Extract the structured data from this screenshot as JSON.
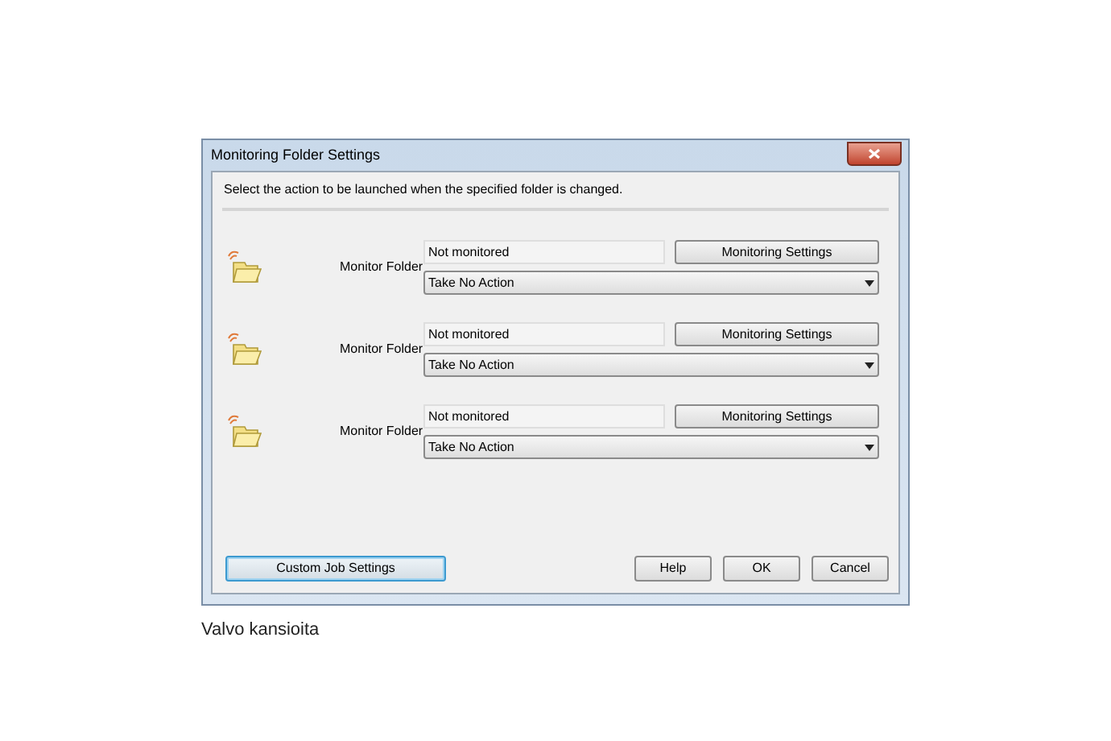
{
  "window": {
    "title": "Monitoring Folder Settings"
  },
  "instruction": "Select the action to be launched when the specified folder is changed.",
  "folders": [
    {
      "label": "Monitor Folder",
      "status": "Not monitored",
      "settings_button": "Monitoring Settings",
      "action": "Take No Action"
    },
    {
      "label": "Monitor Folder",
      "status": "Not monitored",
      "settings_button": "Monitoring Settings",
      "action": "Take No Action"
    },
    {
      "label": "Monitor Folder",
      "status": "Not monitored",
      "settings_button": "Monitoring Settings",
      "action": "Take No Action"
    }
  ],
  "buttons": [
    {
      "label": "Custom Job Settings",
      "kind": "custom",
      "focused": true
    },
    {
      "label": "Help",
      "kind": "dialog",
      "focused": false
    },
    {
      "label": "OK",
      "kind": "dialog",
      "focused": false
    },
    {
      "label": "Cancel",
      "kind": "dialog",
      "focused": false
    }
  ],
  "caption": "Valvo kansioita"
}
